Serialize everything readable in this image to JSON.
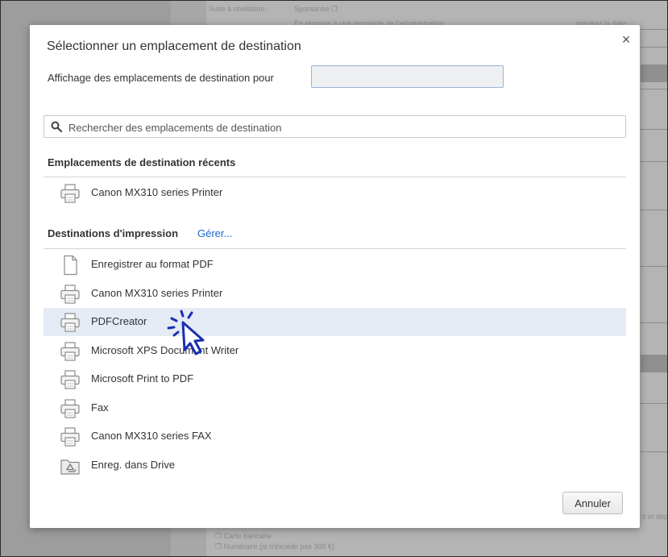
{
  "background_document": {
    "line1": "Suite à révélation :",
    "line1_value": "Spontanée ❐",
    "line2": "En réponse à une demande de l'administration",
    "line2_right": "précisez la date",
    "bottom_right": "it et dép",
    "bottom_item1": "❐ Carte bancaire",
    "bottom_item2": "❐ Numéraire (si n'excède pas 300 €)"
  },
  "dialog": {
    "title": "Sélectionner un emplacement de destination",
    "close_label": "×",
    "account_label": "Affichage des emplacements de destination pour",
    "search_placeholder": "Rechercher des emplacements de destination",
    "recent_header": "Emplacements de destination récents",
    "recent_items": [
      {
        "label": "Canon MX310 series Printer",
        "icon": "printer-icon"
      }
    ],
    "print_header": "Destinations d'impression",
    "manage_link": "Gérer...",
    "print_items": [
      {
        "label": "Enregistrer au format PDF",
        "icon": "document-icon"
      },
      {
        "label": "Canon MX310 series Printer",
        "icon": "printer-icon"
      },
      {
        "label": "PDFCreator",
        "icon": "printer-icon",
        "selected": true
      },
      {
        "label": "Microsoft XPS Document Writer",
        "icon": "printer-icon"
      },
      {
        "label": "Microsoft Print to PDF",
        "icon": "printer-icon"
      },
      {
        "label": "Fax",
        "icon": "printer-icon"
      },
      {
        "label": "Canon MX310 series FAX",
        "icon": "printer-icon"
      },
      {
        "label": "Enreg. dans Drive",
        "icon": "drive-icon"
      }
    ],
    "cancel_label": "Annuler"
  },
  "colors": {
    "link": "#1a66c8",
    "selected_row": "#e4ebf5",
    "cursor": "#1a2fb0"
  }
}
